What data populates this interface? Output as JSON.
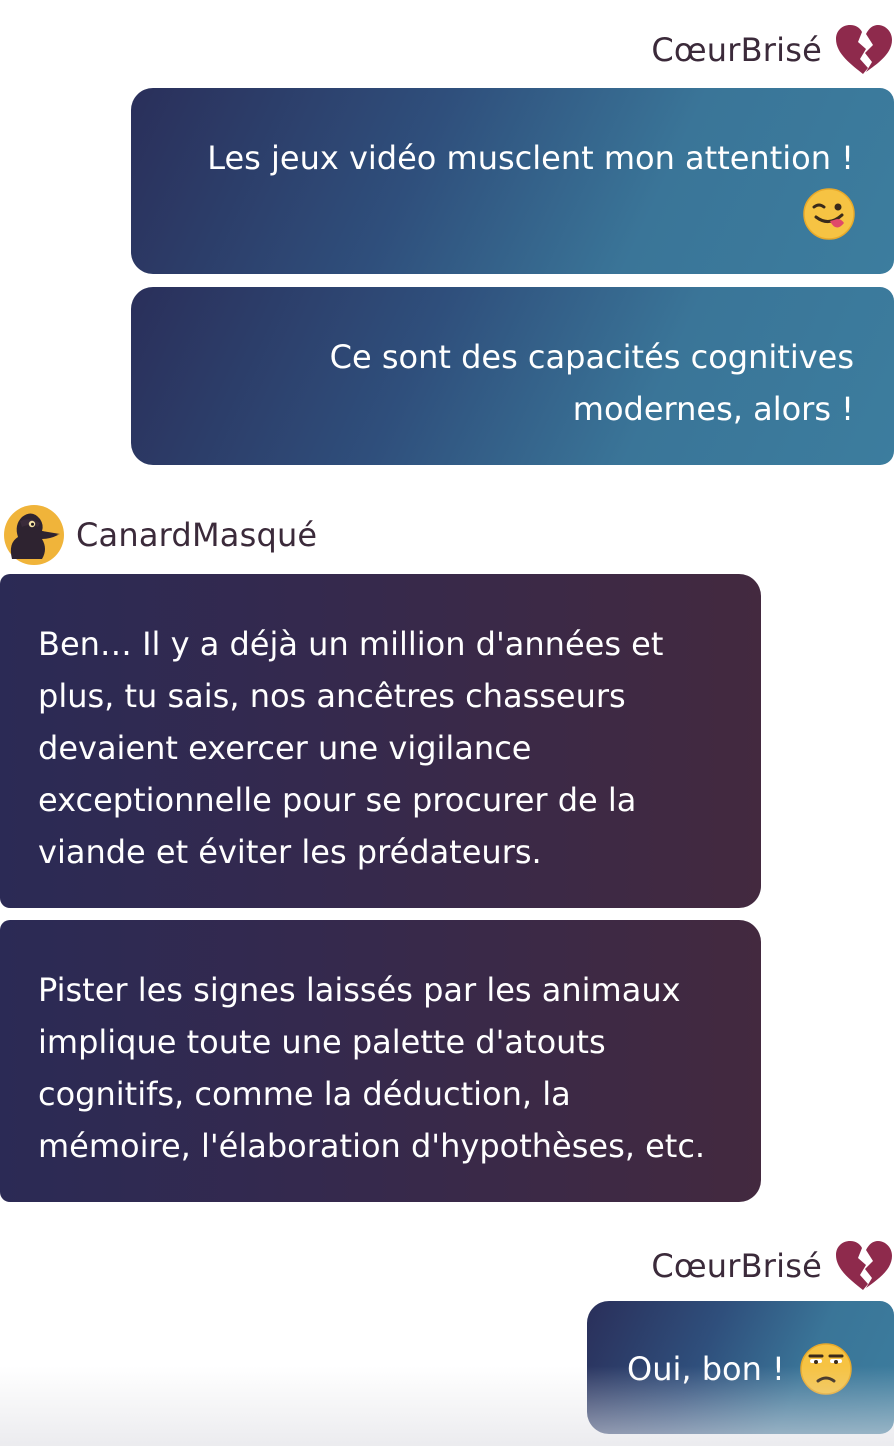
{
  "chat": {
    "messages": [
      {
        "sender": "CœurBrisé",
        "side": "right",
        "sender_icon": "broken-heart-icon",
        "bubbles": [
          {
            "text": "Les jeux vidéo musclent mon attention !",
            "emoji": "winking-tongue-emoji-icon"
          },
          {
            "text": "Ce sont des capacités cognitives modernes, alors !"
          }
        ]
      },
      {
        "sender": "CanardMasqué",
        "side": "left",
        "sender_icon": "masked-duck-avatar-icon",
        "bubbles": [
          {
            "text": "Ben… Il y a déjà un million d'années et plus, tu sais, nos ancêtres chasseurs devaient exercer une vigilance exceptionnelle pour se procurer de la viande et éviter les prédateurs."
          },
          {
            "text": "Pister les signes laissés par les animaux implique toute une palette d'atouts cognitifs, comme la déduction, la mémoire, l'élaboration d'hypothèses, etc."
          }
        ]
      },
      {
        "sender": "CœurBrisé",
        "side": "right",
        "sender_icon": "broken-heart-icon",
        "bubbles": [
          {
            "text": "Oui, bon !",
            "emoji": "unamused-face-emoji-icon"
          }
        ]
      }
    ]
  },
  "colors": {
    "right_bubble_gradient": [
      "#2a2f5a",
      "#3c7d9e"
    ],
    "left_bubble_gradient": [
      "#2b2a55",
      "#43293f"
    ],
    "heart": "#8e2a4c",
    "name_text": "#3b2a3a",
    "emoji_face": "#f6c343"
  }
}
